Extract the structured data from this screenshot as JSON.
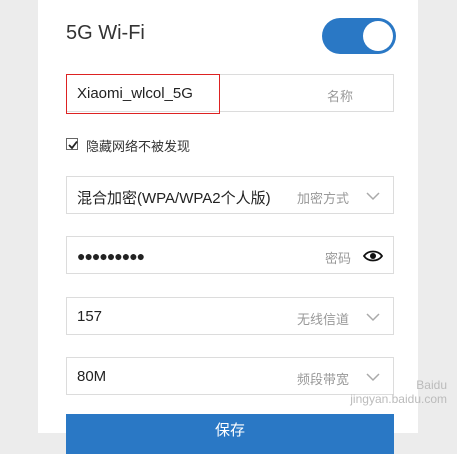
{
  "header": {
    "title": "5G Wi-Fi",
    "toggle_on": true
  },
  "name_field": {
    "value": "Xiaomi_wlcol_5G",
    "label": "名称"
  },
  "hide_network": {
    "checked": true,
    "label": "隐藏网络不被发现"
  },
  "encryption": {
    "value": "混合加密(WPA/WPA2个人版)",
    "label": "加密方式"
  },
  "password": {
    "value": "●●●●●●●●●",
    "label": "密码"
  },
  "channel": {
    "value": "157",
    "label": "无线信道"
  },
  "bandwidth": {
    "value": "80M",
    "label": "频段带宽"
  },
  "save_button": {
    "label": "保存"
  },
  "watermark": {
    "line1": "Baidu",
    "line2": "jingyan.baidu.com"
  },
  "colors": {
    "accent": "#2a78c5",
    "highlight": "#dd2222"
  }
}
